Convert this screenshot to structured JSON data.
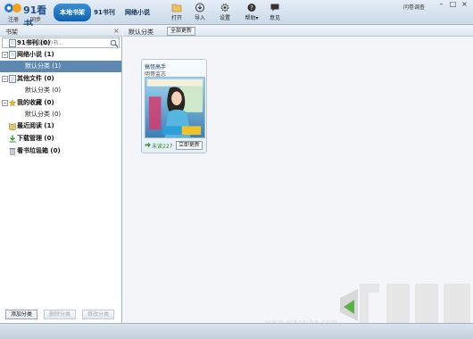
{
  "app": {
    "logo_text": "91看书",
    "register_label": "注册",
    "sync_label": "同步"
  },
  "tabs": [
    {
      "label": "本地书架",
      "active": true
    },
    {
      "label": "91书刊",
      "active": false
    },
    {
      "label": "网络小说",
      "active": false
    }
  ],
  "toolbar": {
    "open_label": "打开",
    "import_label": "导入",
    "settings_label": "设置",
    "help_label": "帮助",
    "feedback_label": "意见"
  },
  "user_text": "问卷调查",
  "sidebar": {
    "title": "书架",
    "search_placeholder": "搜索要找的书..."
  },
  "tree": {
    "node0": "91书刊 (0)",
    "node1": "网络小说 (1)",
    "node1_child": "默认分类 (1)",
    "node2": "其他文件 (0)",
    "node2_child": "默认分类 (0)",
    "node3": "我的收藏 (0)",
    "node3_child": "默认分类 (0)",
    "node4": "最近阅读 (1)",
    "node5": "下载管理 (0)",
    "node6": "看书垃圾箱 (0)"
  },
  "sidebar_buttons": {
    "add": "添加分类",
    "delete": "删除分类",
    "edit": "修改分类"
  },
  "main": {
    "breadcrumb": "默认分类",
    "update_all_label": "全部更新"
  },
  "book": {
    "title": "搞怪高手",
    "author": "明哥监志",
    "unread": "未读227",
    "update_label": "立即更新"
  },
  "watermark": {
    "url": "www.xiazaiba.com"
  },
  "colors": {
    "accent": "#1a6fc4",
    "selected_row": "#5f88b1",
    "unread_green": "#2a8a2a",
    "watermark_gray": "#e5e5e5"
  }
}
